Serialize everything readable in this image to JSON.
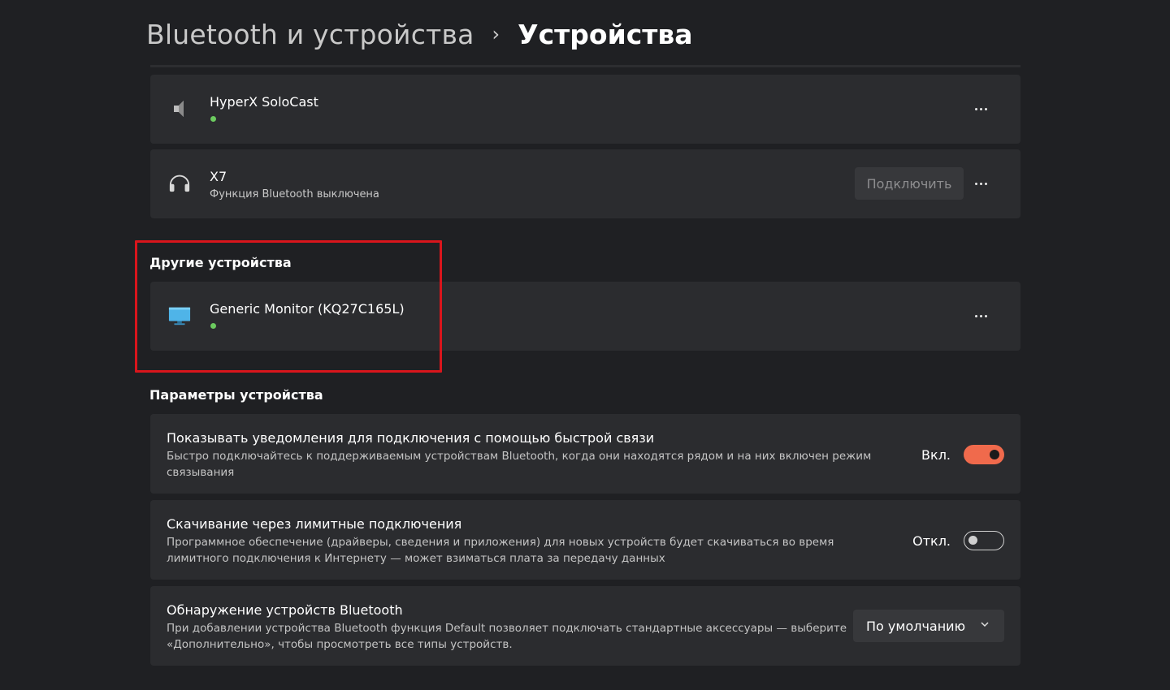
{
  "breadcrumb": {
    "parent": "Bluetooth и устройства",
    "separator": "›",
    "current": "Устройства"
  },
  "devices": [
    {
      "name": "HyperX SoloCast",
      "subtitle": "",
      "status": "connected",
      "icon": "speaker-icon",
      "action": ""
    },
    {
      "name": "X7",
      "subtitle": "Функция Bluetooth выключена",
      "status": "",
      "icon": "headphones-icon",
      "action": "Подключить"
    }
  ],
  "other_devices": {
    "heading": "Другие устройства",
    "items": [
      {
        "name": "Generic Monitor (KQ27C165L)",
        "status": "connected",
        "icon": "monitor-icon"
      }
    ]
  },
  "device_settings": {
    "heading": "Параметры устройства",
    "items": [
      {
        "title": "Показывать уведомления для подключения с помощью быстрой связи",
        "description": "Быстро подключайтесь к поддерживаемым устройствам Bluetooth, когда они находятся рядом и на них включен режим связывания",
        "state_label": "Вкл.",
        "toggle_on": true
      },
      {
        "title": "Скачивание через лимитные подключения",
        "description": "Программное обеспечение (драйверы, сведения и приложения) для новых устройств будет скачиваться во время лимитного подключения к Интернету — может взиматься плата за передачу данных",
        "state_label": "Откл.",
        "toggle_on": false
      },
      {
        "title": "Обнаружение устройств Bluetooth",
        "description": "При добавлении устройства Bluetooth функция Default позволяет подключать стандартные аксессуары — выберите «Дополнительно», чтобы просмотреть все типы устройств.",
        "dropdown_value": "По умолчанию"
      }
    ]
  },
  "colors": {
    "accent": "#f06a4c",
    "status_green": "#6ccb5f",
    "highlight_border": "#d9151c",
    "card_bg": "#2b2c2f",
    "page_bg": "#1f2023"
  }
}
